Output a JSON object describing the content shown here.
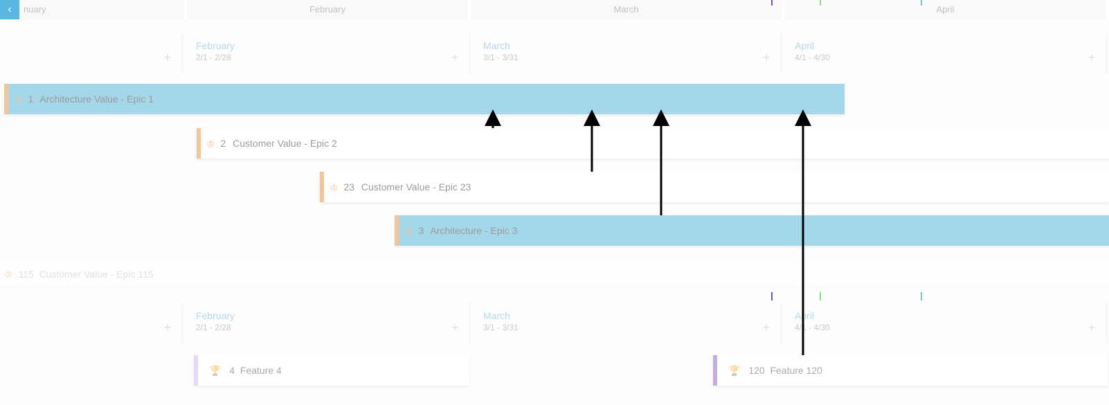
{
  "months": {
    "january": "nuary",
    "february": "February",
    "march": "March",
    "april": "April"
  },
  "periods_top": {
    "feb": {
      "title": "February",
      "range": "2/1 - 2/28"
    },
    "mar": {
      "title": "March",
      "range": "3/1 - 3/31"
    },
    "apr": {
      "title": "April",
      "range": "4/1 - 4/30"
    }
  },
  "periods_bottom": {
    "feb": {
      "title": "February",
      "range": "2/1 - 2/28"
    },
    "mar": {
      "title": "March",
      "range": "3/1 - 3/31"
    },
    "apr": {
      "title": "April",
      "range": "4/1 - 4/30"
    }
  },
  "epics": {
    "epic1": {
      "id": "1",
      "label": "Architecture Value - Epic 1"
    },
    "epic2": {
      "id": "2",
      "label": "Customer Value - Epic 2"
    },
    "epic23": {
      "id": "23",
      "label": "Customer Value - Epic 23"
    },
    "epic3": {
      "id": "3",
      "label": "Architecture - Epic 3"
    },
    "epic115": {
      "id": "115",
      "label": "Customer Value - Epic 115"
    }
  },
  "features": {
    "feat4": {
      "id": "4",
      "label": "Feature 4"
    },
    "feat120": {
      "id": "120",
      "label": "Feature 120"
    }
  },
  "colors": {
    "epic_accent": "#e87c1a",
    "epic_fill_blue": "#36a7cf",
    "feature_accent": "#7a4fb3",
    "feature_accent_light": "#c9a8e8",
    "period_title": "#5ba9d6"
  }
}
